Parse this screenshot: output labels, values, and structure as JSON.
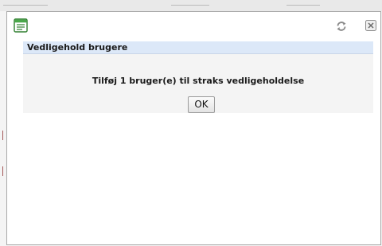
{
  "dialog": {
    "icons": {
      "title": "form-document-icon",
      "refresh": "refresh-icon",
      "close": "close-icon"
    },
    "section_title": "Vedligehold brugere",
    "message": "Tilføj 1 bruger(e) til straks vedligeholdelse",
    "ok_label": "OK"
  },
  "colors": {
    "header_bg": "#dce8f8",
    "content_bg": "#f4f4f4",
    "icon_green": "#3e9a3e"
  }
}
